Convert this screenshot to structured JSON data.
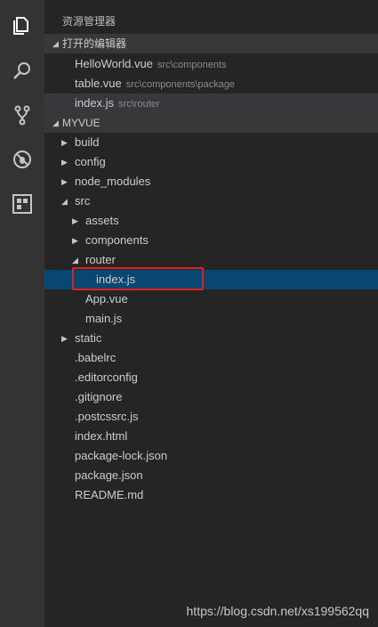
{
  "activity_bar": {
    "icons": [
      "files-icon",
      "search-icon",
      "source-control-icon",
      "debug-icon",
      "extensions-icon"
    ]
  },
  "explorer": {
    "title": "资源管理器",
    "open_editors": {
      "header": "打开的编辑器",
      "items": [
        {
          "name": "HelloWorld.vue",
          "path": "src\\components"
        },
        {
          "name": "table.vue",
          "path": "src\\components\\package"
        },
        {
          "name": "index.js",
          "path": "src\\router"
        }
      ]
    },
    "project": {
      "header": "MYVUE",
      "tree": [
        {
          "label": "build"
        },
        {
          "label": "config"
        },
        {
          "label": "node_modules"
        },
        {
          "label": "src"
        },
        {
          "label": "assets"
        },
        {
          "label": "components"
        },
        {
          "label": "router"
        },
        {
          "label": "index.js"
        },
        {
          "label": "App.vue"
        },
        {
          "label": "main.js"
        },
        {
          "label": "static"
        },
        {
          "label": ".babelrc"
        },
        {
          "label": ".editorconfig"
        },
        {
          "label": ".gitignore"
        },
        {
          "label": ".postcssrc.js"
        },
        {
          "label": "index.html"
        },
        {
          "label": "package-lock.json"
        },
        {
          "label": "package.json"
        },
        {
          "label": "README.md"
        }
      ]
    }
  },
  "watermark": "https://blog.csdn.net/xs199562qq"
}
